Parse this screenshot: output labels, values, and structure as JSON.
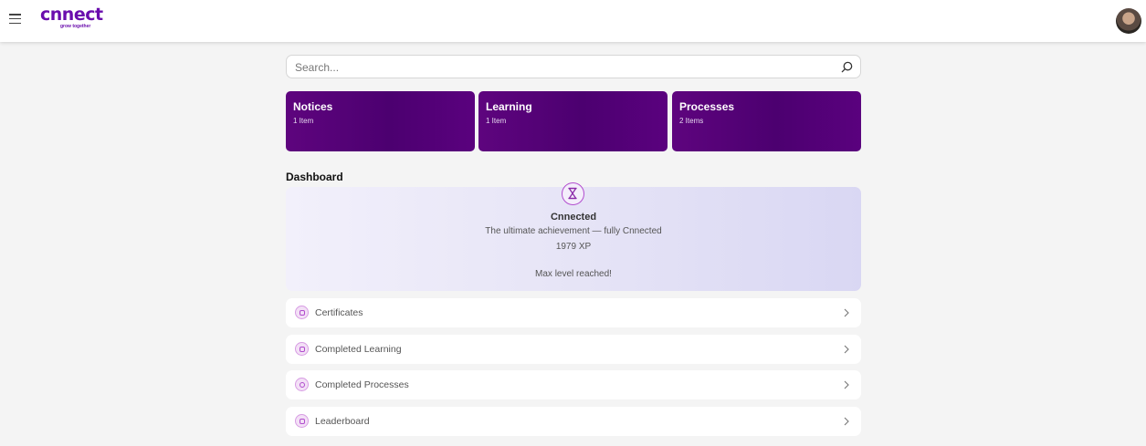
{
  "header": {
    "logo_text": "cnnect",
    "logo_tagline": "grow together",
    "menu_icon": "hamburger-icon",
    "avatar_icon": "user-avatar"
  },
  "search": {
    "placeholder": "Search...",
    "value": "",
    "icon": "search-icon"
  },
  "tiles": [
    {
      "title": "Notices",
      "count": "1 Item"
    },
    {
      "title": "Learning",
      "count": "1 Item"
    },
    {
      "title": "Processes",
      "count": "2 Items"
    }
  ],
  "dashboard": {
    "title": "Dashboard",
    "achievement": {
      "icon": "trophy-hourglass-icon",
      "name": "Cnnected",
      "description": "The ultimate achievement — fully Cnnected",
      "xp": "1979 XP",
      "status": "Max level reached!"
    }
  },
  "list": [
    {
      "label": "Certificates",
      "icon": "certificate-icon"
    },
    {
      "label": "Completed Learning",
      "icon": "learning-icon"
    },
    {
      "label": "Completed Processes",
      "icon": "process-icon"
    },
    {
      "label": "Leaderboard",
      "icon": "leaderboard-icon"
    }
  ],
  "colors": {
    "brand": "#6a0dad",
    "tile_bg": "#4c0070",
    "accent": "#b24dcf",
    "page_bg": "#f4f4f4"
  }
}
